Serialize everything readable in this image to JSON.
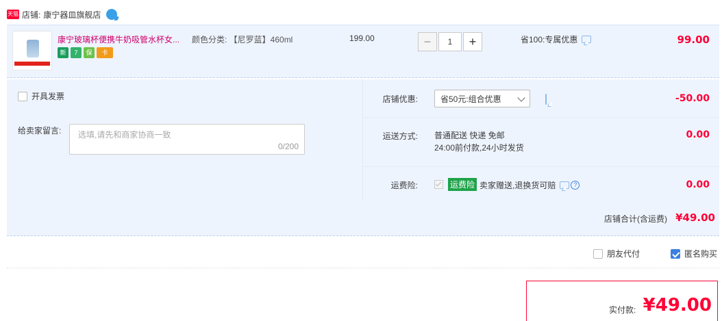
{
  "store": {
    "badge": "天猫",
    "label": "店铺:",
    "name": "康宁器皿旗舰店"
  },
  "item": {
    "title": "康宁玻璃杯便携牛奶吸管水杯女...",
    "sku": "颜色分类: 【尼罗蓝】460ml",
    "price": "199.00",
    "quantity": "1",
    "minus": "−",
    "plus": "+",
    "promo": "省100:专属优惠",
    "total": "99.00",
    "tags": [
      "新",
      "7",
      "保",
      "卡"
    ]
  },
  "extras": {
    "invoice_label": "开具发票",
    "message_label": "给卖家留言:",
    "message_placeholder": "选填,请先和商家协商一致",
    "message_count": "0/200",
    "store_discount_label": "店铺优惠:",
    "store_discount_selected": "省50元:组合优惠",
    "store_discount_value": "-50.00",
    "shipping_label": "运送方式:",
    "shipping_line1": "普通配送 快递 免邮",
    "shipping_line2": "24:00前付款,24小时发货",
    "shipping_value": "0.00",
    "insurance_label": "运费险:",
    "insurance_badge": "运费险",
    "insurance_text": "卖家赠送,退换货可赔",
    "insurance_help": "?",
    "insurance_value": "0.00"
  },
  "store_total": {
    "label": "店铺合计(含运费)",
    "value": "¥49.00"
  },
  "options": {
    "friend_pay": "朋友代付",
    "anonymous": "匿名购买"
  },
  "payment": {
    "label": "实付款:",
    "value": "¥49.00"
  },
  "colors": {
    "accent_red": "#ff0036",
    "title_pink": "#d0006c",
    "panel_bg": "#eef4fe",
    "check_blue": "#3d7fe0"
  }
}
